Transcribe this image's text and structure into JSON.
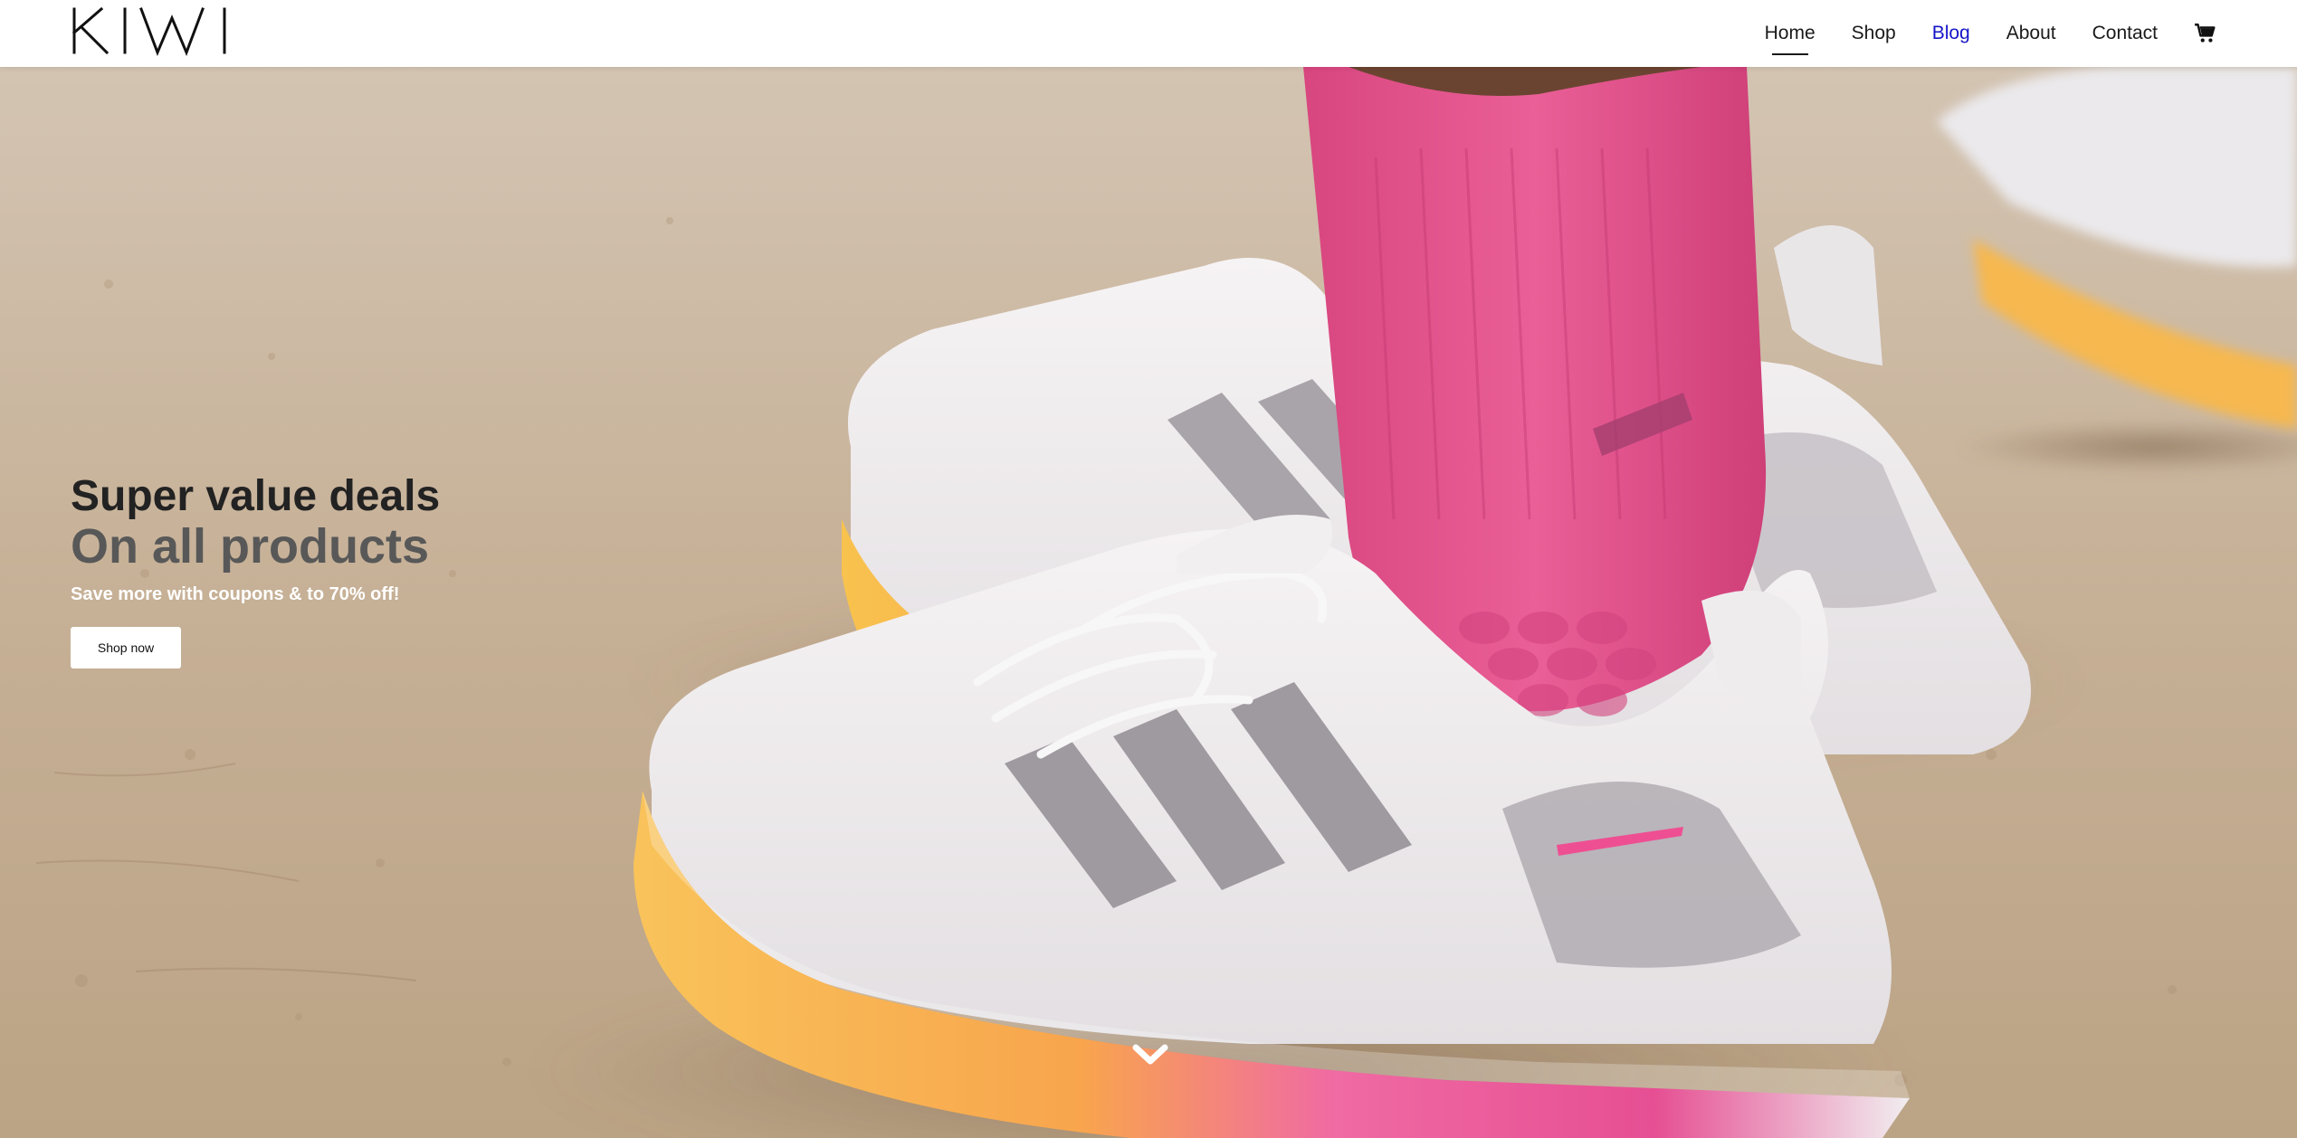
{
  "header": {
    "logo_text": "KIWI",
    "nav": [
      {
        "label": "Home",
        "state": "active"
      },
      {
        "label": "Shop",
        "state": "normal"
      },
      {
        "label": "Blog",
        "state": "visited"
      },
      {
        "label": "About",
        "state": "normal"
      },
      {
        "label": "Contact",
        "state": "normal"
      }
    ],
    "cart_icon": "cart-icon"
  },
  "hero": {
    "title": "Super value deals",
    "subtitle": "On all products",
    "tagline": "Save more with coupons & to 70% off!",
    "button_label": "Shop now",
    "scroll_icon": "chevron-down-icon"
  },
  "colors": {
    "nav_text": "#1a1a1a",
    "nav_visited": "#1515c8",
    "title": "#222222",
    "subtitle": "#585858",
    "tagline": "#ffffff",
    "ground": "#c9b59c",
    "sock": "#e5558f",
    "sole_yellow": "#f8b84e",
    "sole_pink": "#ee4f93"
  }
}
